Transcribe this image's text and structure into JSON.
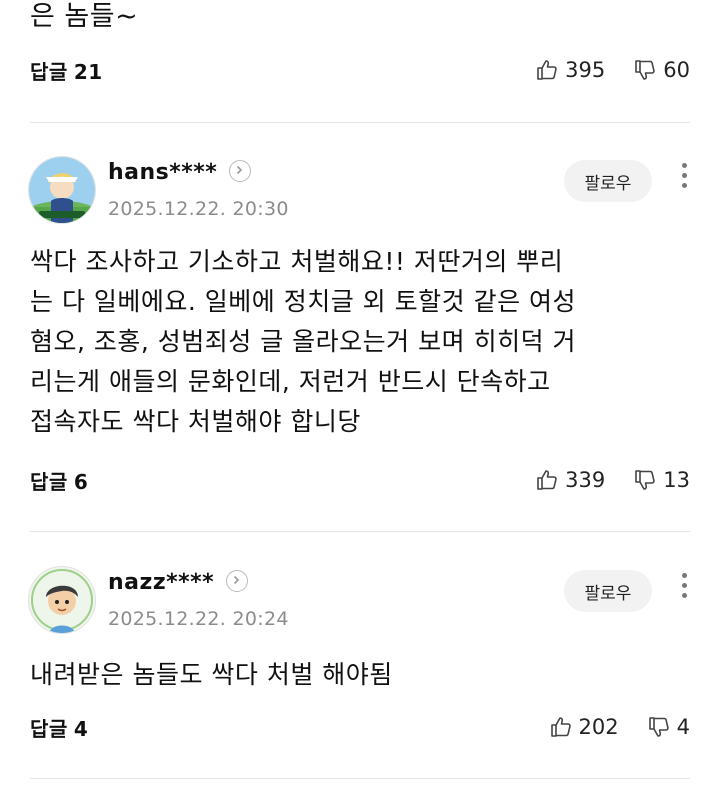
{
  "top_tail": {
    "text": "은 놈들~",
    "reply_label": "답글",
    "reply_count": "21",
    "likes": "395",
    "dislikes": "60"
  },
  "comments": [
    {
      "username": "hans****",
      "date": "2025.12.22. 20:30",
      "follow_label": "팔로우",
      "lines": [
        "싹다 조사하고 기소하고 처벌해요!! 저딴거의 뿌리",
        "는 다 일베에요. 일베에 정치글 외 토할것 같은 여성",
        "혐오, 조홍, 성범죄성 글 올라오는거 보며 히히덕 거",
        "리는게 애들의 문화인데, 저런거 반드시 단속하고",
        "접속자도 싹다 처벌해야 합니당"
      ],
      "reply_label": "답글",
      "reply_count": "6",
      "likes": "339",
      "dislikes": "13"
    },
    {
      "username": "nazz****",
      "date": "2025.12.22. 20:24",
      "follow_label": "팔로우",
      "lines": [
        "내려받은 놈들도 싹다 처벌 해야됨"
      ],
      "reply_label": "답글",
      "reply_count": "4",
      "likes": "202",
      "dislikes": "4"
    }
  ],
  "icons": {
    "like": "thumbs-up-icon",
    "dislike": "thumbs-down-icon",
    "more": "more-vertical-icon",
    "profile_link": "chevron-right-circle-icon"
  }
}
